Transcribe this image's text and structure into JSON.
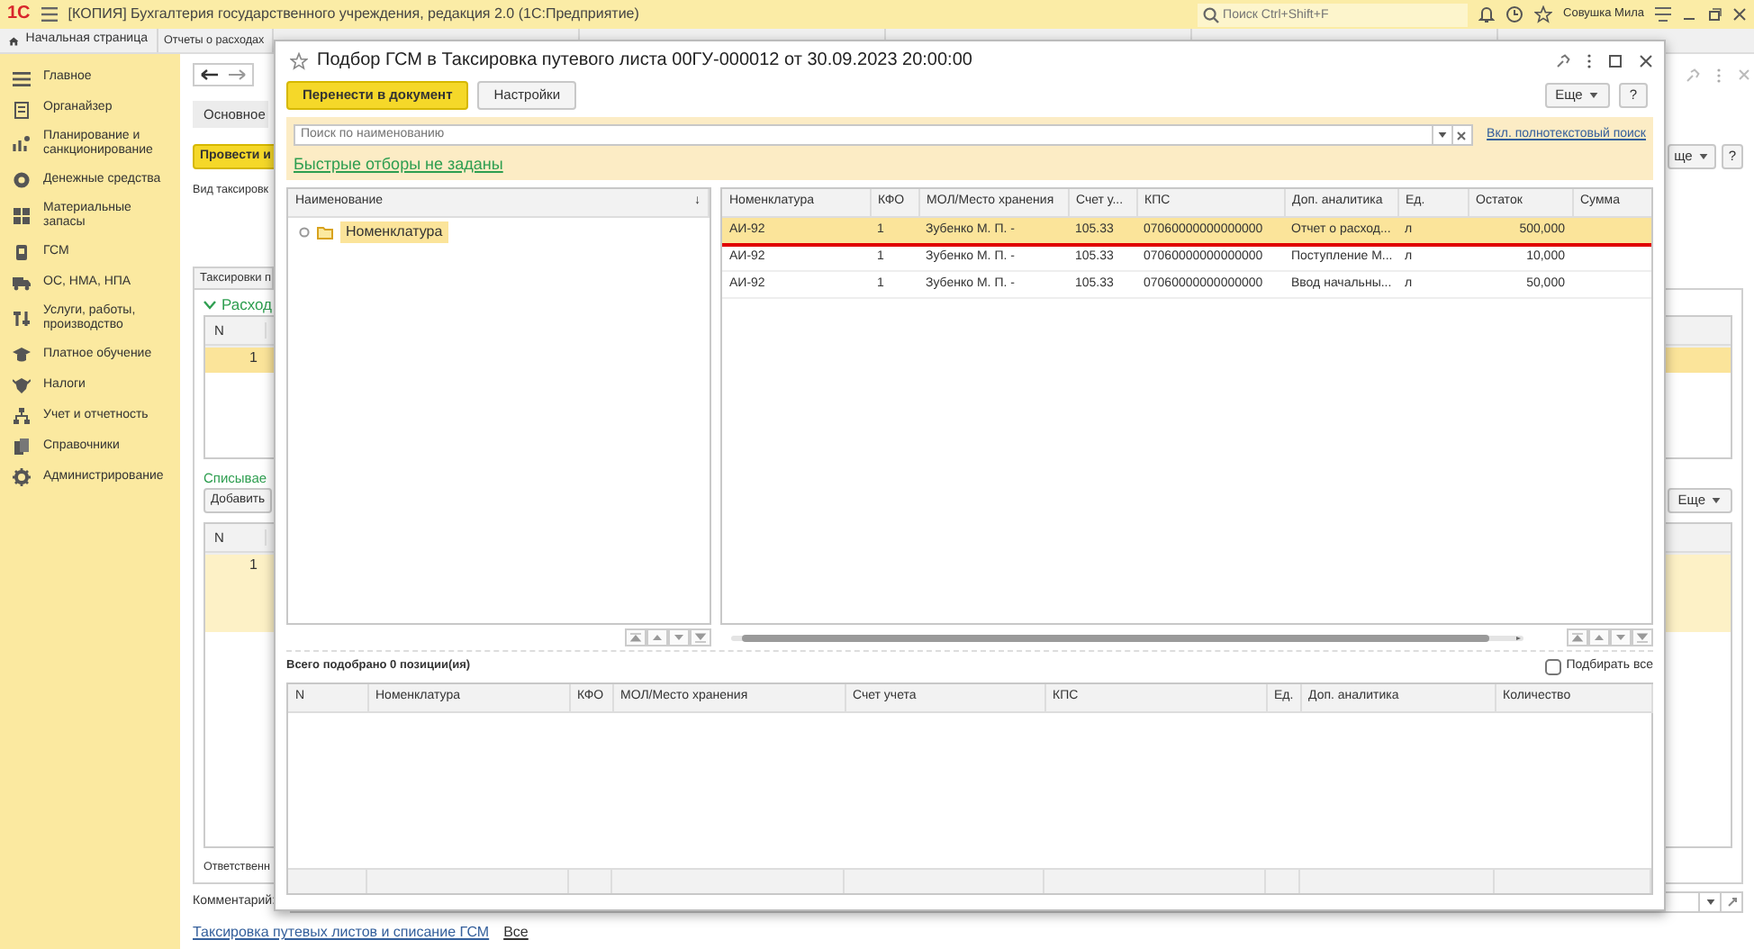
{
  "app": {
    "logo": "1С",
    "title": "[КОПИЯ] Бухгалтерия государственного учреждения, редакция 2.0  (1С:Предприятие)",
    "search_placeholder": "Поиск Ctrl+Shift+F",
    "user": "Совушка Мила"
  },
  "tabs": [
    {
      "label": "Начальная страница",
      "kind": "home",
      "selected": false
    },
    {
      "label": "Отчеты о расходах",
      "kind": "plain",
      "selected": false
    }
  ],
  "sidebar": {
    "items": [
      {
        "label": "Главное"
      },
      {
        "label": "Органайзер"
      },
      {
        "label": "Планирование и санкционирование"
      },
      {
        "label": "Денежные средства"
      },
      {
        "label": "Материальные запасы"
      },
      {
        "label": "ГСМ"
      },
      {
        "label": "ОС, НМА, НПА"
      },
      {
        "label": "Услуги, работы, производство"
      },
      {
        "label": "Платное обучение"
      },
      {
        "label": "Налоги"
      },
      {
        "label": "Учет и отчетность"
      },
      {
        "label": "Справочники"
      },
      {
        "label": "Администрирование"
      }
    ]
  },
  "document_form": {
    "form_tab": "Основное",
    "post_button": "Провести и",
    "more_button_top": "ще",
    "help_button": "?",
    "type_label": "Вид таксировк",
    "panel_tab": "Таксировки п",
    "section_1": {
      "title": "Расход",
      "expanded": true,
      "columns": [
        "N"
      ],
      "rows": [
        {
          "n": "1",
          "selected": true
        }
      ]
    },
    "section_2": {
      "title": "Списывае",
      "add_button": "Добавить",
      "more_button": "Еще",
      "columns": [
        "N"
      ],
      "rows": [
        {
          "n": "1",
          "selected": false
        }
      ]
    },
    "responsible_label": "Ответственн",
    "comment_label": "Комментарий:",
    "footer_links": [
      "Таксировка путевых листов и списание ГСМ",
      "Все"
    ]
  },
  "dialog": {
    "title": "Подбор ГСМ в Таксировка путевого листа 00ГУ-000012 от 30.09.2023 20:00:00",
    "buttons": [
      {
        "label": "Перенести в документ",
        "kind": "primary"
      },
      {
        "label": "Настройки",
        "kind": "plain"
      }
    ],
    "more_button": "Еще",
    "help_button": "?",
    "search": {
      "placeholder": "Поиск по наименованию"
    },
    "fulltext_link": "Вкл. полнотекстовый поиск",
    "quick_filters_link": "Быстрые отборы не заданы",
    "tree": {
      "column": "Наименование",
      "sort_mark": "↓",
      "items": [
        {
          "label": "Номенклатура",
          "selected": true
        }
      ]
    },
    "stock_table": {
      "columns": [
        "Номенклатура",
        "КФО",
        "МОЛ/Место хранения",
        "Счет у...",
        "КПС",
        "Доп. аналитика",
        "Ед.",
        "Остаток",
        "Сумма"
      ],
      "rows": [
        {
          "cells": [
            "АИ-92",
            "1",
            "Зубенко М. П. -",
            "105.33",
            "07060000000000000",
            "Отчет о расход...",
            "л",
            "500,000"
          ],
          "selected": true
        },
        {
          "cells": [
            "АИ-92",
            "1",
            "Зубенко М. П. -",
            "105.33",
            "07060000000000000",
            "Поступление М...",
            "л",
            "10,000"
          ],
          "selected": false
        },
        {
          "cells": [
            "АИ-92",
            "1",
            "Зубенко М. П. -",
            "105.33",
            "07060000000000000",
            "Ввод начальны...",
            "л",
            "50,000"
          ],
          "selected": false
        }
      ]
    },
    "total_label": "Всего подобрано 0 позиции(ия)",
    "select_all": {
      "label": "Подбирать все",
      "checked": false
    },
    "picked_table": {
      "columns": [
        "N",
        "Номенклатура",
        "КФО",
        "МОЛ/Место хранения",
        "Счет учета",
        "КПС",
        "Ед.",
        "Доп. аналитика",
        "Количество"
      ]
    }
  }
}
